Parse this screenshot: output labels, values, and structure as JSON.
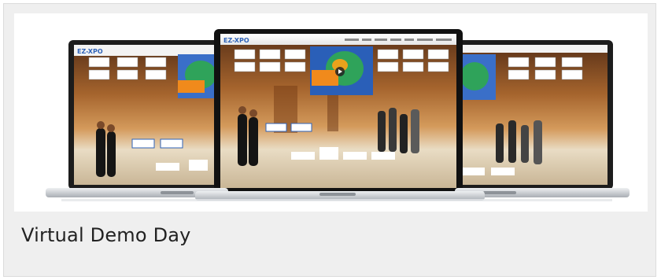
{
  "card": {
    "caption": "Virtual Demo Day"
  },
  "image": {
    "logo_text": "EZ-XPO",
    "colors": {
      "wood": "#9a5a2a",
      "floor": "#d8c6a4",
      "frame": "#1a1a1a",
      "base": "#c9cdd2",
      "accent_blue": "#2f63b8"
    }
  }
}
